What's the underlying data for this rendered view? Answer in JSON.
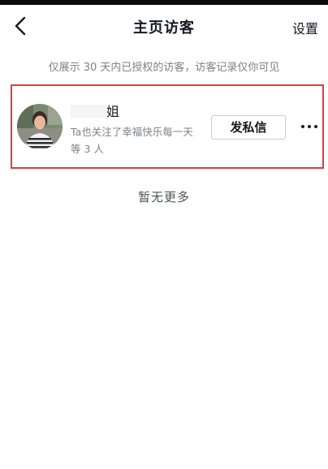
{
  "top_bar": {
    "title": "主页访客",
    "settings_label": "设置",
    "back_icon": "chevron-left-icon"
  },
  "notice_text": "仅展示 30 天内已授权的访客，访客记录仅你可见",
  "visitor": {
    "name_visible": "姐",
    "name_redacted": true,
    "description": "Ta也关注了幸福快乐每一天等 3 人",
    "message_button_label": "发私信",
    "more_icon": "more-dots-icon"
  },
  "no_more_text": "暂无更多",
  "colors": {
    "highlight_border": "#e03a3e",
    "primary_text": "#161823",
    "secondary_text": "#7f8088"
  }
}
